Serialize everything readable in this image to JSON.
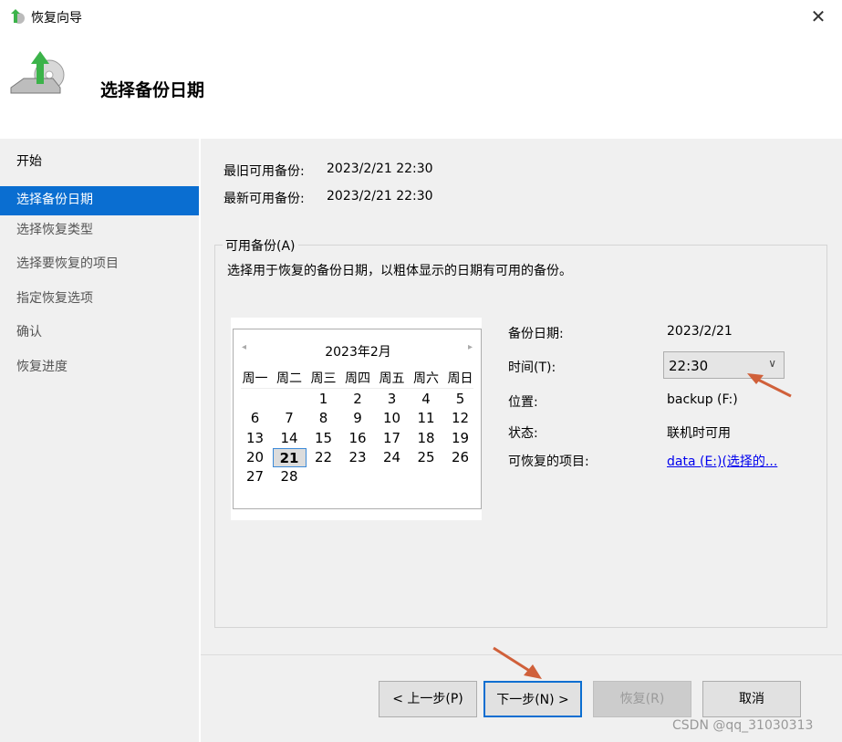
{
  "window": {
    "title": "恢复向导",
    "close": "✕"
  },
  "header": {
    "heading": "选择备份日期"
  },
  "sidebar": {
    "items": [
      {
        "label": "开始"
      },
      {
        "label": "选择备份日期"
      },
      {
        "label": "选择恢复类型"
      },
      {
        "label": "选择要恢复的项目"
      },
      {
        "label": "指定恢复选项"
      },
      {
        "label": "确认"
      },
      {
        "label": "恢复进度"
      }
    ]
  },
  "main": {
    "oldest_label": "最旧可用备份:",
    "oldest_value": "2023/2/21 22:30",
    "newest_label": "最新可用备份:",
    "newest_value": "2023/2/21 22:30",
    "group_title": "可用备份(A)",
    "group_desc": "选择用于恢复的备份日期，以粗体显示的日期有可用的备份。",
    "calendar": {
      "month": "2023年2月",
      "prev": "◂",
      "next": "▸",
      "weekdays": [
        "周一",
        "周二",
        "周三",
        "周四",
        "周五",
        "周六",
        "周日"
      ],
      "first_weekday_index": 2,
      "days_in_month": 28,
      "selected": 21
    },
    "details": {
      "date_label": "备份日期:",
      "date_value": "2023/2/21",
      "time_label": "时间(T):",
      "time_value": "22:30",
      "location_label": "位置:",
      "location_value": "backup (F:)",
      "status_label": "状态:",
      "status_value": "联机时可用",
      "items_label": "可恢复的项目:",
      "items_link": "data (E:)(选择的..."
    }
  },
  "footer": {
    "prev": "< 上一步(P)",
    "next": "下一步(N) >",
    "restore": "恢复(R)",
    "cancel": "取消"
  },
  "watermark": "CSDN @qq_31030313",
  "colors": {
    "accent": "#0a6ed1",
    "annotation_arrow": "#d0603a"
  }
}
